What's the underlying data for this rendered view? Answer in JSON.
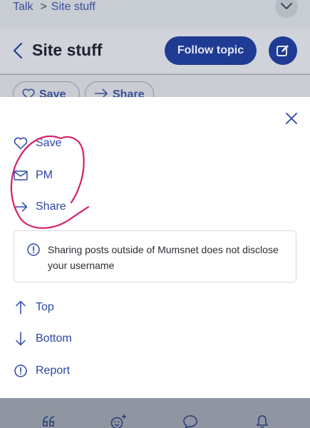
{
  "breadcrumb": {
    "parent": "Talk",
    "separator": ">",
    "current": "Site stuff"
  },
  "header": {
    "title": "Site stuff",
    "follow_label": "Follow topic"
  },
  "behind_chips": [
    {
      "label": "Save"
    },
    {
      "label": "Share"
    }
  ],
  "sheet": {
    "menu": [
      {
        "label": "Save",
        "icon": "heart-icon"
      },
      {
        "label": "PM",
        "icon": "envelope-icon"
      },
      {
        "label": "Share",
        "icon": "arrow-right-icon"
      }
    ],
    "notice": "Sharing posts outside of Mumsnet does not disclose your username",
    "nav": [
      {
        "label": "Top",
        "icon": "arrow-up-icon"
      },
      {
        "label": "Bottom",
        "icon": "arrow-down-icon"
      },
      {
        "label": "Report",
        "icon": "alert-circle-icon"
      }
    ]
  },
  "tabbar": {
    "icons": [
      "quote-icon",
      "add-reaction-icon",
      "speech-bubble-icon",
      "bell-icon"
    ]
  },
  "colors": {
    "accent": "#2b47a8",
    "button": "#1f3b93",
    "annotation": "#d6206a",
    "overlay": "#8f96a1"
  }
}
